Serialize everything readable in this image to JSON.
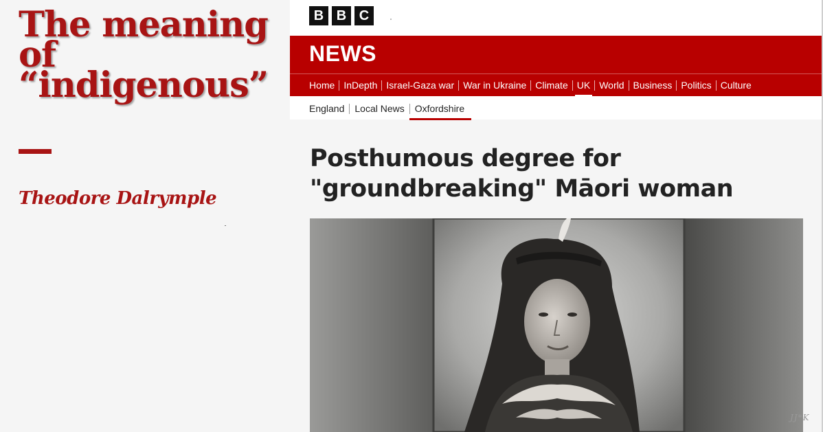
{
  "article": {
    "title_lines": [
      "The meaning",
      "of",
      "“indigenous”"
    ],
    "author": "Theodore Dalrymple"
  },
  "bbc": {
    "logo_letters": [
      "B",
      "B",
      "C"
    ],
    "section_title": "NEWS",
    "primary_nav": [
      {
        "label": "Home",
        "active": false
      },
      {
        "label": "InDepth",
        "active": false
      },
      {
        "label": "Israel-Gaza war",
        "active": false
      },
      {
        "label": "War in Ukraine",
        "active": false
      },
      {
        "label": "Climate",
        "active": false
      },
      {
        "label": "UK",
        "active": true
      },
      {
        "label": "World",
        "active": false
      },
      {
        "label": "Business",
        "active": false
      },
      {
        "label": "Politics",
        "active": false
      },
      {
        "label": "Culture",
        "active": false
      }
    ],
    "secondary_nav": [
      {
        "label": "England",
        "active": false
      },
      {
        "label": "Local News",
        "active": false
      },
      {
        "label": "Oxfordshire",
        "active": true
      }
    ],
    "headline_lines": [
      "Posthumous degree for",
      "\"groundbreaking\" Māori woman"
    ]
  },
  "watermark": "JJ*K",
  "colors": {
    "bbc_red": "#b80000",
    "article_red": "#a81414"
  }
}
